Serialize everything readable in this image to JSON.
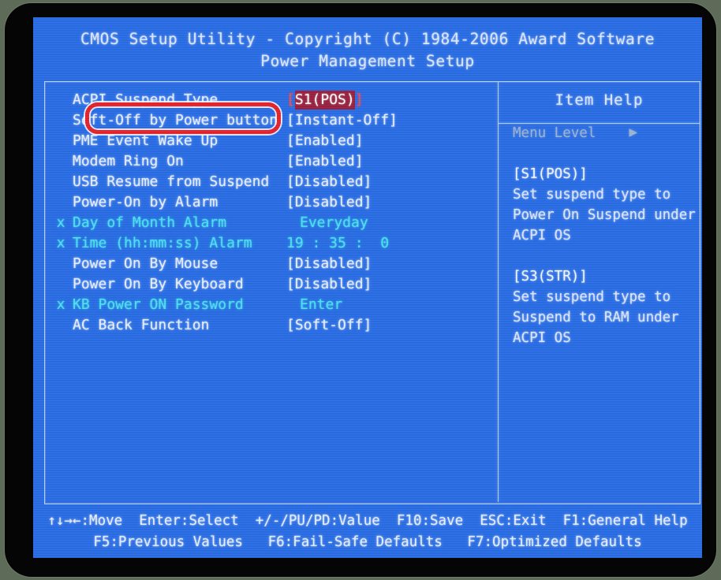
{
  "screen": {
    "title_line1": "CMOS Setup Utility - Copyright (C) 1984-2006 Award Software",
    "title_line2": "Power Management Setup",
    "bg_color": "#2a6ee6",
    "text_color": "#dfe9ff",
    "dim_color": "#4de4f5",
    "highlight_bg": "#9a2240",
    "annotation_color": "#e8232b"
  },
  "menu": {
    "rows": [
      {
        "mark": "",
        "label": "ACPI Suspend Type",
        "value": "[S1(POS)]",
        "value_core": "S1(POS)",
        "state": "normal",
        "selected": true,
        "indent": false
      },
      {
        "mark": "",
        "label": "Soft-Off by Power button",
        "value": "[Instant-Off]",
        "state": "normal",
        "selected": false,
        "indent": false
      },
      {
        "mark": "",
        "label": "PME Event Wake Up",
        "value": "[Enabled]",
        "state": "normal",
        "selected": false,
        "indent": false
      },
      {
        "mark": "",
        "label": "Modem Ring On",
        "value": "[Enabled]",
        "state": "normal",
        "selected": false,
        "indent": false
      },
      {
        "mark": "",
        "label": "USB Resume from Suspend",
        "value": "[Disabled]",
        "state": "normal",
        "selected": false,
        "indent": false
      },
      {
        "mark": "",
        "label": "Power-On by Alarm",
        "value": "[Disabled]",
        "state": "normal",
        "selected": false,
        "indent": false
      },
      {
        "mark": "x",
        "label": "Day of Month Alarm",
        "value": "Everyday",
        "state": "dim",
        "selected": false,
        "indent": true
      },
      {
        "mark": "x",
        "label": "Time (hh:mm:ss) Alarm",
        "value": "19 : 35 :  0",
        "state": "dim",
        "selected": false,
        "indent": false
      },
      {
        "mark": "",
        "label": "Power On By Mouse",
        "value": "[Disabled]",
        "state": "normal",
        "selected": false,
        "indent": false
      },
      {
        "mark": "",
        "label": "Power On By Keyboard",
        "value": "[Disabled]",
        "state": "normal",
        "selected": false,
        "indent": false
      },
      {
        "mark": "x",
        "label": "KB Power ON Password",
        "value": "Enter",
        "state": "dim",
        "selected": false,
        "indent": true
      },
      {
        "mark": "",
        "label": "AC Back Function",
        "value": "[Soft-Off]",
        "state": "normal",
        "selected": false,
        "indent": false
      }
    ]
  },
  "help": {
    "title": "Item Help",
    "menu_level_label": "Menu Level",
    "menu_level_arrow": "▶",
    "lines": [
      {
        "text": "[S1(POS)]",
        "style": "strong"
      },
      {
        "text": "Set suspend type to",
        "style": "normal"
      },
      {
        "text": "Power On Suspend under",
        "style": "normal"
      },
      {
        "text": "ACPI OS",
        "style": "normal"
      },
      {
        "text": "",
        "style": "blank"
      },
      {
        "text": "[S3(STR)]",
        "style": "strong"
      },
      {
        "text": "Set suspend type to",
        "style": "normal"
      },
      {
        "text": "Suspend to RAM under",
        "style": "normal"
      },
      {
        "text": "ACPI OS",
        "style": "normal"
      }
    ]
  },
  "footer": {
    "line1": "↑↓→←:Move  Enter:Select  +/-/PU/PD:Value  F10:Save  ESC:Exit  F1:General Help",
    "line2": "F5:Previous Values   F6:Fail-Safe Defaults   F7:Optimized Defaults"
  }
}
